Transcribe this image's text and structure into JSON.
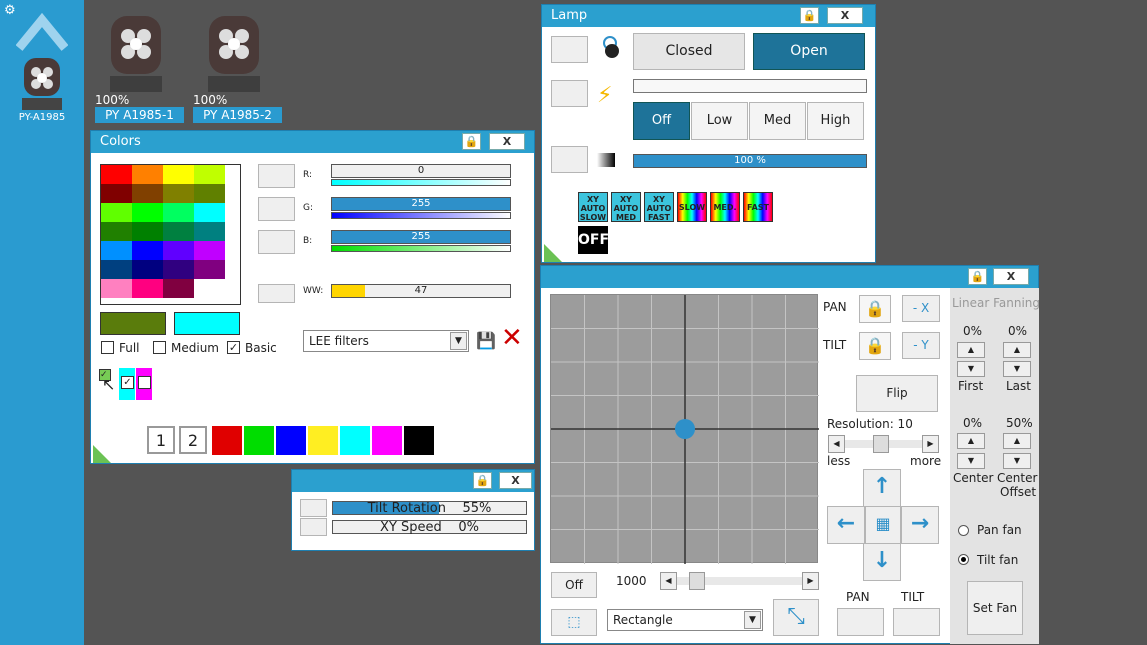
{
  "sidebar": {
    "fixture_label": "PY-A1985"
  },
  "fixtures": [
    {
      "pct": "100%",
      "label": "PY A1985-1"
    },
    {
      "pct": "100%",
      "label": "PY A1985-2"
    }
  ],
  "colors": {
    "title": "Colors",
    "close": "X",
    "palette": [
      [
        "#ff0000",
        "#ff8000",
        "#ffff00",
        "#c0ff00"
      ],
      [
        "#800000",
        "#804000",
        "#808000",
        "#608000"
      ],
      [
        "#60ff00",
        "#00ff00",
        "#00ff60",
        "#00ffff"
      ],
      [
        "#208000",
        "#008000",
        "#008040",
        "#008080"
      ],
      [
        "#0090ff",
        "#0000ff",
        "#6000ff",
        "#c000ff"
      ],
      [
        "#004080",
        "#000080",
        "#300080",
        "#800080"
      ],
      [
        "#ff80c0",
        "#ff0080",
        "#800040",
        "#ffffff"
      ]
    ],
    "channels": [
      {
        "label": "R:",
        "value": "0",
        "fill": 0
      },
      {
        "label": "G:",
        "value": "255",
        "fill": 1
      },
      {
        "label": "B:",
        "value": "255",
        "fill": 1
      }
    ],
    "ww": {
      "label": "WW:",
      "value": "47",
      "fill": 0.184
    },
    "current_swatches": [
      "#5a7c0c",
      "#00ffff"
    ],
    "options": [
      {
        "label": "Full",
        "checked": false
      },
      {
        "label": "Medium",
        "checked": false
      },
      {
        "label": "Basic",
        "checked": true
      }
    ],
    "filter_select": "LEE filters",
    "pages": [
      "1",
      "2"
    ],
    "quick_colors": [
      "#e00000",
      "#00dd00",
      "#0000ff",
      "#ffee22",
      "#00ffff",
      "#ff00ff",
      "#000000"
    ],
    "accent": "#2ba0cf"
  },
  "lamp": {
    "title": "Lamp",
    "close": "X",
    "closed": "Closed",
    "open": "Open",
    "modes": [
      "Off",
      "Low",
      "Med",
      "High"
    ],
    "dimmer_text": "100 %",
    "dimmer_fill": 1,
    "macros": [
      {
        "l1": "XY",
        "l2": "AUTO",
        "l3": "SLOW"
      },
      {
        "l1": "XY",
        "l2": "AUTO",
        "l3": "MED"
      },
      {
        "l1": "XY",
        "l2": "AUTO",
        "l3": "FAST"
      },
      {
        "l1": "SLOW"
      },
      {
        "l1": "MED."
      },
      {
        "l1": "FAST"
      }
    ],
    "off_macro": "OFF"
  },
  "speed": {
    "close": "X",
    "rows": [
      {
        "label": "Tilt Rotation",
        "value": "55%",
        "fill": 0.55
      },
      {
        "label": "XY Speed",
        "value": "0%",
        "fill": 0
      }
    ]
  },
  "pantilt": {
    "close": "X",
    "pan_label": "PAN",
    "tilt_label": "TILT",
    "invert_x": "- X",
    "invert_y": "- Y",
    "flip": "Flip",
    "resolution": "Resolution: 10",
    "less": "less",
    "more": "more",
    "off": "Off",
    "speed_value": "1000",
    "shape_select": "Rectangle",
    "pan_btn": "PAN",
    "tilt_btn": "TILT",
    "fanning": {
      "title": "Linear Fanning",
      "first_pct": "0%",
      "last_pct": "0%",
      "first": "First",
      "last": "Last",
      "center_pct": "0%",
      "offset_pct": "50%",
      "center": "Center",
      "center_offset_1": "Center",
      "center_offset_2": "Offset",
      "pan_fan": "Pan fan",
      "tilt_fan": "Tilt fan",
      "set_fan": "Set Fan"
    },
    "accent": "#2e90c9"
  }
}
